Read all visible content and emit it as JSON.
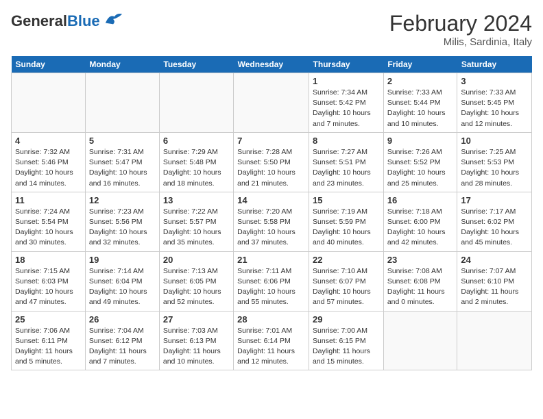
{
  "header": {
    "logo_general": "General",
    "logo_blue": "Blue",
    "title": "February 2024",
    "subtitle": "Milis, Sardinia, Italy"
  },
  "weekdays": [
    "Sunday",
    "Monday",
    "Tuesday",
    "Wednesday",
    "Thursday",
    "Friday",
    "Saturday"
  ],
  "weeks": [
    [
      {
        "day": "",
        "info": ""
      },
      {
        "day": "",
        "info": ""
      },
      {
        "day": "",
        "info": ""
      },
      {
        "day": "",
        "info": ""
      },
      {
        "day": "1",
        "info": "Sunrise: 7:34 AM\nSunset: 5:42 PM\nDaylight: 10 hours\nand 7 minutes."
      },
      {
        "day": "2",
        "info": "Sunrise: 7:33 AM\nSunset: 5:44 PM\nDaylight: 10 hours\nand 10 minutes."
      },
      {
        "day": "3",
        "info": "Sunrise: 7:33 AM\nSunset: 5:45 PM\nDaylight: 10 hours\nand 12 minutes."
      }
    ],
    [
      {
        "day": "4",
        "info": "Sunrise: 7:32 AM\nSunset: 5:46 PM\nDaylight: 10 hours\nand 14 minutes."
      },
      {
        "day": "5",
        "info": "Sunrise: 7:31 AM\nSunset: 5:47 PM\nDaylight: 10 hours\nand 16 minutes."
      },
      {
        "day": "6",
        "info": "Sunrise: 7:29 AM\nSunset: 5:48 PM\nDaylight: 10 hours\nand 18 minutes."
      },
      {
        "day": "7",
        "info": "Sunrise: 7:28 AM\nSunset: 5:50 PM\nDaylight: 10 hours\nand 21 minutes."
      },
      {
        "day": "8",
        "info": "Sunrise: 7:27 AM\nSunset: 5:51 PM\nDaylight: 10 hours\nand 23 minutes."
      },
      {
        "day": "9",
        "info": "Sunrise: 7:26 AM\nSunset: 5:52 PM\nDaylight: 10 hours\nand 25 minutes."
      },
      {
        "day": "10",
        "info": "Sunrise: 7:25 AM\nSunset: 5:53 PM\nDaylight: 10 hours\nand 28 minutes."
      }
    ],
    [
      {
        "day": "11",
        "info": "Sunrise: 7:24 AM\nSunset: 5:54 PM\nDaylight: 10 hours\nand 30 minutes."
      },
      {
        "day": "12",
        "info": "Sunrise: 7:23 AM\nSunset: 5:56 PM\nDaylight: 10 hours\nand 32 minutes."
      },
      {
        "day": "13",
        "info": "Sunrise: 7:22 AM\nSunset: 5:57 PM\nDaylight: 10 hours\nand 35 minutes."
      },
      {
        "day": "14",
        "info": "Sunrise: 7:20 AM\nSunset: 5:58 PM\nDaylight: 10 hours\nand 37 minutes."
      },
      {
        "day": "15",
        "info": "Sunrise: 7:19 AM\nSunset: 5:59 PM\nDaylight: 10 hours\nand 40 minutes."
      },
      {
        "day": "16",
        "info": "Sunrise: 7:18 AM\nSunset: 6:00 PM\nDaylight: 10 hours\nand 42 minutes."
      },
      {
        "day": "17",
        "info": "Sunrise: 7:17 AM\nSunset: 6:02 PM\nDaylight: 10 hours\nand 45 minutes."
      }
    ],
    [
      {
        "day": "18",
        "info": "Sunrise: 7:15 AM\nSunset: 6:03 PM\nDaylight: 10 hours\nand 47 minutes."
      },
      {
        "day": "19",
        "info": "Sunrise: 7:14 AM\nSunset: 6:04 PM\nDaylight: 10 hours\nand 49 minutes."
      },
      {
        "day": "20",
        "info": "Sunrise: 7:13 AM\nSunset: 6:05 PM\nDaylight: 10 hours\nand 52 minutes."
      },
      {
        "day": "21",
        "info": "Sunrise: 7:11 AM\nSunset: 6:06 PM\nDaylight: 10 hours\nand 55 minutes."
      },
      {
        "day": "22",
        "info": "Sunrise: 7:10 AM\nSunset: 6:07 PM\nDaylight: 10 hours\nand 57 minutes."
      },
      {
        "day": "23",
        "info": "Sunrise: 7:08 AM\nSunset: 6:08 PM\nDaylight: 11 hours\nand 0 minutes."
      },
      {
        "day": "24",
        "info": "Sunrise: 7:07 AM\nSunset: 6:10 PM\nDaylight: 11 hours\nand 2 minutes."
      }
    ],
    [
      {
        "day": "25",
        "info": "Sunrise: 7:06 AM\nSunset: 6:11 PM\nDaylight: 11 hours\nand 5 minutes."
      },
      {
        "day": "26",
        "info": "Sunrise: 7:04 AM\nSunset: 6:12 PM\nDaylight: 11 hours\nand 7 minutes."
      },
      {
        "day": "27",
        "info": "Sunrise: 7:03 AM\nSunset: 6:13 PM\nDaylight: 11 hours\nand 10 minutes."
      },
      {
        "day": "28",
        "info": "Sunrise: 7:01 AM\nSunset: 6:14 PM\nDaylight: 11 hours\nand 12 minutes."
      },
      {
        "day": "29",
        "info": "Sunrise: 7:00 AM\nSunset: 6:15 PM\nDaylight: 11 hours\nand 15 minutes."
      },
      {
        "day": "",
        "info": ""
      },
      {
        "day": "",
        "info": ""
      }
    ]
  ]
}
